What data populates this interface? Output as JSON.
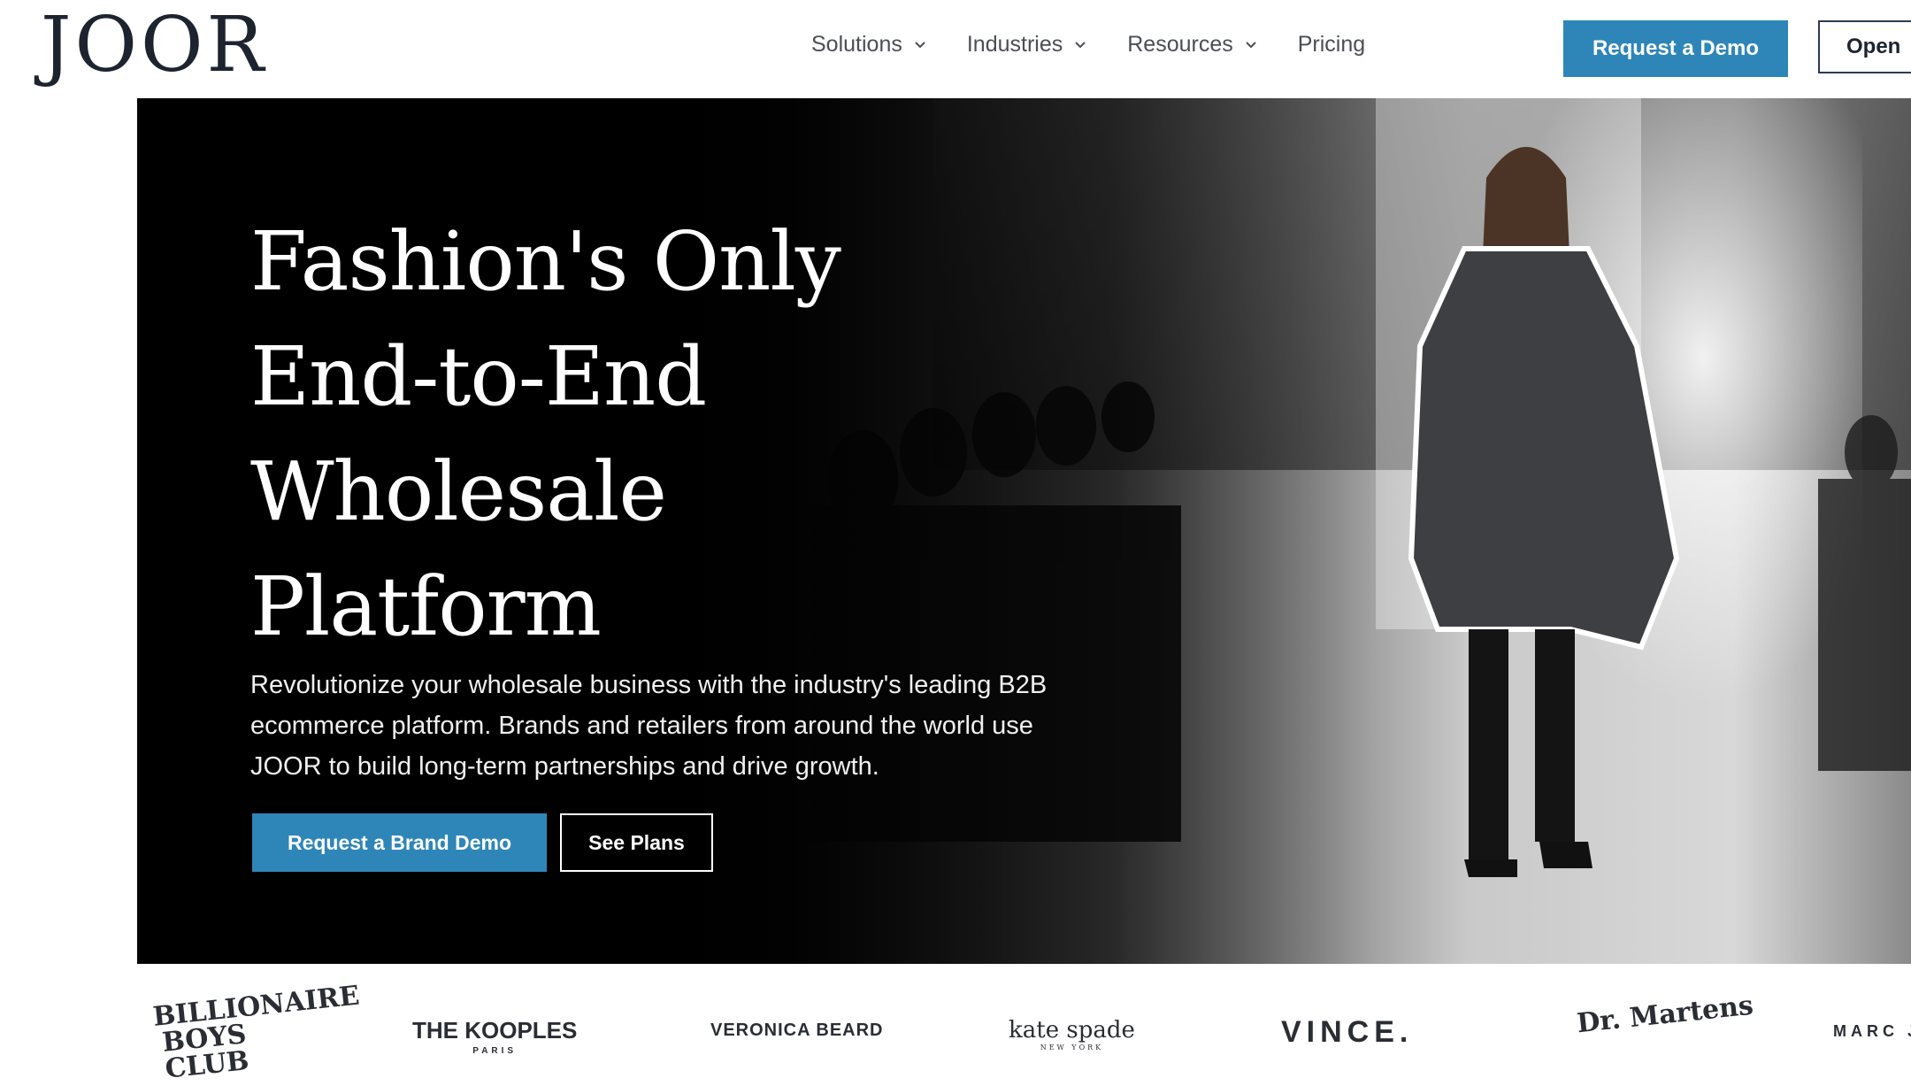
{
  "nav": {
    "logo": "JOOR",
    "items": [
      {
        "label": "Solutions",
        "has_dropdown": true
      },
      {
        "label": "Industries",
        "has_dropdown": true
      },
      {
        "label": "Resources",
        "has_dropdown": true
      },
      {
        "label": "Pricing",
        "has_dropdown": false
      }
    ],
    "request_demo": "Request a Demo",
    "open_label": "Open"
  },
  "hero": {
    "title_lines": [
      "Fashion's Only",
      "End-to-End",
      "Wholesale",
      "Platform"
    ],
    "subtitle": "Revolutionize your wholesale business with the industry's leading B2B ecommerce platform. Brands and retailers from around the world use JOOR to build long-term partnerships and drive growth.",
    "primary_cta": "Request a Brand Demo",
    "secondary_cta": "See Plans"
  },
  "brands": {
    "b1": "BILLIONAIRE BOYS CLUB",
    "b2": "THE KOOPLES",
    "b2_sub": "PARIS",
    "b3": "VERONICA BEARD",
    "b4": "kate spade",
    "b4_sub": "NEW YORK",
    "b5": "VINCE.",
    "b6": "Dr. Martens",
    "b7": "MARC J"
  },
  "colors": {
    "accent": "#2e86b8",
    "text_dark": "#1d2430",
    "hero_bg": "#020202"
  }
}
